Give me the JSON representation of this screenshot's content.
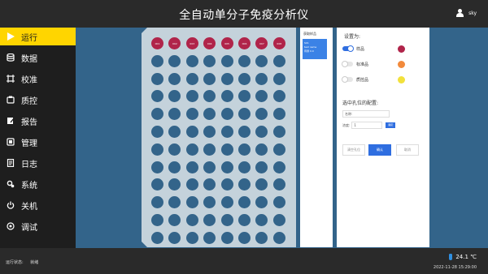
{
  "header": {
    "title": "全自动单分子免疫分析仪",
    "username": "sky"
  },
  "sidebar": {
    "items": [
      {
        "label": "运行",
        "icon": "play-icon",
        "active": true
      },
      {
        "label": "数据",
        "icon": "database-icon",
        "active": false
      },
      {
        "label": "校准",
        "icon": "calibration-icon",
        "active": false
      },
      {
        "label": "质控",
        "icon": "quality-control-icon",
        "active": false
      },
      {
        "label": "报告",
        "icon": "report-icon",
        "active": false
      },
      {
        "label": "管理",
        "icon": "management-icon",
        "active": false
      },
      {
        "label": "日志",
        "icon": "log-icon",
        "active": false
      },
      {
        "label": "系统",
        "icon": "settings-icon",
        "active": false
      },
      {
        "label": "关机",
        "icon": "power-icon",
        "active": false
      },
      {
        "label": "调试",
        "icon": "debug-icon",
        "active": false
      }
    ]
  },
  "plate": {
    "rows": 12,
    "cols": 8,
    "selected_row_labels": [
      "001",
      "002",
      "003",
      "004",
      "005",
      "006",
      "007",
      "008"
    ]
  },
  "sample_panel": {
    "title": "获取样品",
    "card_lines": [
      "S01",
      "test name",
      "待测 0.0"
    ]
  },
  "settings": {
    "title": "设置为:",
    "options": [
      {
        "label": "样品",
        "on": true,
        "color": "#b0244a"
      },
      {
        "label": "标准品",
        "on": false,
        "color": "#f28a3c"
      },
      {
        "label": "质控品",
        "on": false,
        "color": "#f2e13c"
      }
    ],
    "selected_title": "选中孔位的配置:",
    "name_field": "名称:",
    "conc_label": "浓度:",
    "conc_value": "1",
    "conc_button": "确定",
    "buttons": {
      "reset": "清空孔位",
      "confirm": "确认",
      "cancel": "取消"
    }
  },
  "footer": {
    "run_state_label": "运行状态:",
    "run_state_value": "就绪",
    "temperature": "24.1 ℃",
    "datetime": "2022-11-28 15:29:00"
  }
}
